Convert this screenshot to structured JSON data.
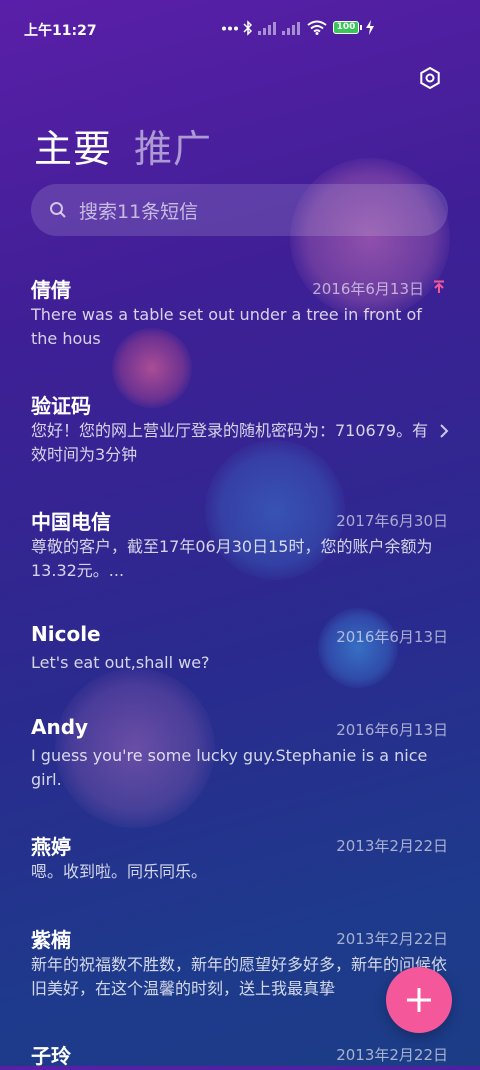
{
  "status_bar": {
    "time": "上午11:27",
    "battery": "100"
  },
  "tabs": [
    {
      "label": "主要",
      "active": true
    },
    {
      "label": "推广",
      "active": false
    }
  ],
  "search": {
    "placeholder": "搜索11条短信"
  },
  "messages": [
    {
      "name": "倩倩",
      "date": "2016年6月13日",
      "pinned": true,
      "preview": "There was a table set out under a tree in front of the hous"
    },
    {
      "name": "验证码",
      "date": "",
      "preview": "您好！您的网上营业厅登录的随机密码为：710679。有效时间为3分钟"
    },
    {
      "name": "中国电信",
      "date": "2017年6月30日",
      "preview": "尊敬的客户，截至17年06月30日15时，您的账户余额为13.32元。..."
    },
    {
      "name": "Nicole",
      "date": "2016年6月13日",
      "preview": "Let's eat out,shall we?"
    },
    {
      "name": "Andy",
      "date": "2016年6月13日",
      "preview": "I guess you're some lucky guy.Stephanie is a nice girl."
    },
    {
      "name": "燕婷",
      "date": "2013年2月22日",
      "preview": "嗯。收到啦。同乐同乐。"
    },
    {
      "name": "紫楠",
      "date": "2013年2月22日",
      "preview": "新年的祝福数不胜数，新年的愿望好多好多，新年的问候依旧美好，在这个温馨的时刻，送上我最真挚"
    },
    {
      "name": "子玲",
      "date": "2013年2月22日",
      "preview": ""
    }
  ],
  "colors": {
    "accent": "#f4579a",
    "pin": "#f4579a"
  }
}
